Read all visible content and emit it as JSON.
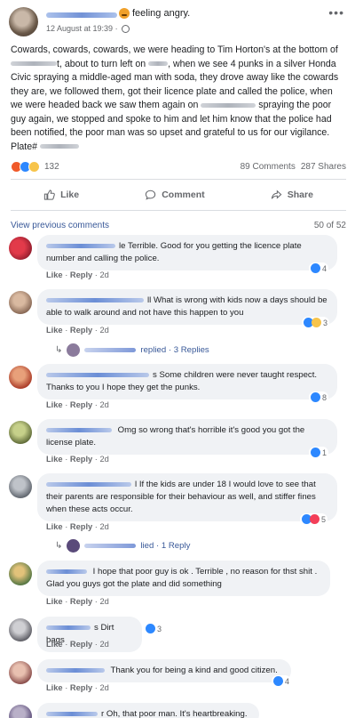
{
  "post": {
    "feeling": "feeling angry.",
    "date": "12 August at 19:39 ·",
    "text_parts": [
      "Cowards, cowards, cowards, we were heading to Tim Horton's at the bottom of ",
      "t, about to turn left on ",
      ", when we see 4 punks in a silver Honda Civic spraying a middle-aged man with soda, they drove away like the cowards they are, we followed them, got their licence plate and called the police, when we were headed back we saw them again on ",
      " spraying the poor guy again, we stopped and spoke to him and let him know that the police had been notified, the poor man was so upset and grateful to us for our vigilance. Plate# "
    ],
    "reactions_count": "132",
    "comments_count": "89 Comments",
    "shares_count": "287 Shares",
    "actions": {
      "like": "Like",
      "comment": "Comment",
      "share": "Share"
    }
  },
  "comments_header": {
    "view_previous": "View previous comments",
    "counter": "50 of 52"
  },
  "comments": [
    {
      "name_suffix": "le",
      "text": "Terrible. Good for you getting the licence plate number and calling the police.",
      "like": "Like",
      "reply": "Reply",
      "time": "2d",
      "reactions": "4"
    },
    {
      "name_suffix": "ll",
      "text": "What is wrong with kids now a days should be able to walk around and not have this happen to you",
      "like": "Like",
      "reply": "Reply",
      "time": "2d",
      "reactions": "3",
      "replies": "replied · 3 Replies"
    },
    {
      "name_suffix": "s",
      "text": "Some children were never taught respect. Thanks to you I hope they get the punks.",
      "like": "Like",
      "reply": "Reply",
      "time": "2d",
      "reactions": "8"
    },
    {
      "name_suffix": "",
      "text": "Omg so wrong that's horrible it's good you got the license plate.",
      "like": "Like",
      "reply": "Reply",
      "time": "2d",
      "reactions": "1"
    },
    {
      "name_suffix": "l",
      "text": "If the kids are under 18 I would love to see that their parents are responsible for their behaviour as well, and stiffer fines when these acts occur.",
      "like": "Like",
      "reply": "Reply",
      "time": "2d",
      "reactions": "5",
      "replies": "lied · 1 Reply"
    },
    {
      "name_suffix": "",
      "text": "I hope that poor guy is ok . Terrible , no reason for thst shit . Glad you guys got the plate and did something",
      "like": "Like",
      "reply": "Reply",
      "time": "2d",
      "reactions": ""
    },
    {
      "name_suffix": "s",
      "text": "Dirt bags",
      "like": "Like",
      "reply": "Reply",
      "time": "2d",
      "reactions": "3"
    },
    {
      "name_suffix": "",
      "text": "Thank you for being a kind and good citizen.",
      "like": "Like",
      "reply": "Reply",
      "time": "2d",
      "reactions": "4"
    },
    {
      "name_suffix": "r",
      "text": "Oh, that poor man. It's heartbreaking."
    }
  ],
  "colors": {
    "link": "#385898",
    "meta": "#65676b",
    "bubble": "#f0f2f5",
    "like_blue": "#2d88ff"
  }
}
